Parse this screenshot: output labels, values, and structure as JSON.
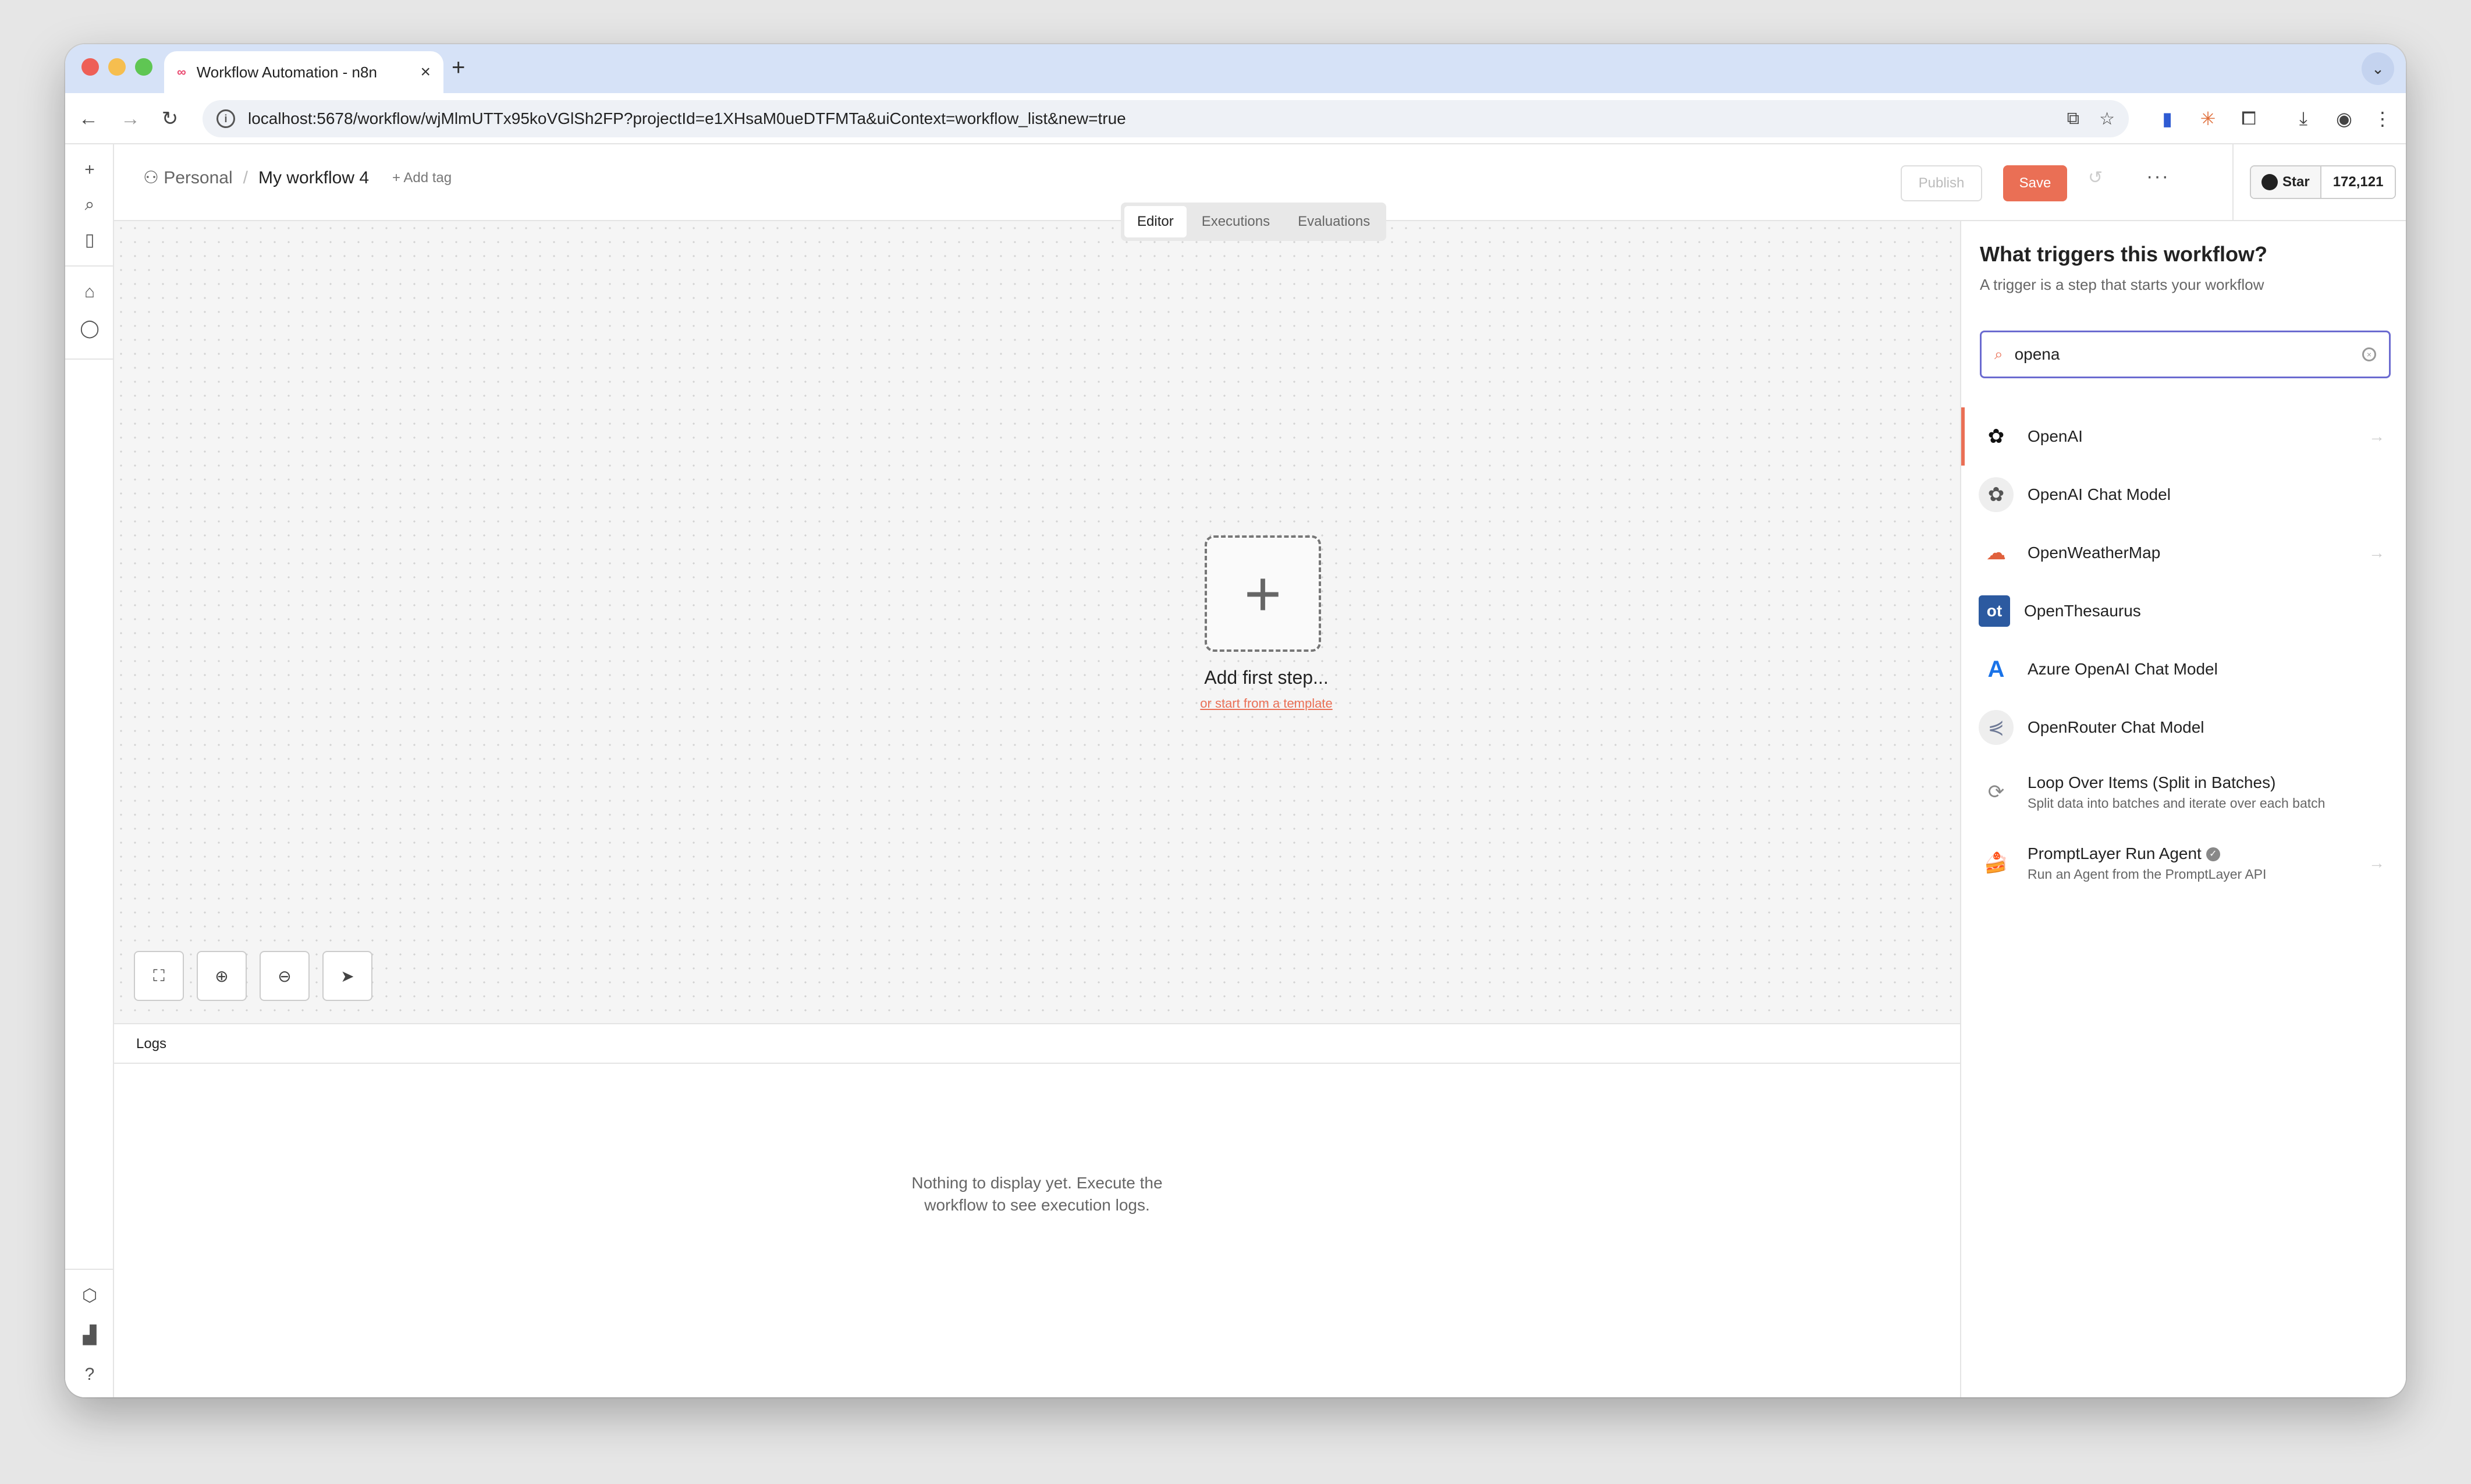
{
  "browser": {
    "tab_title": "Workflow Automation - n8n",
    "url": "localhost:5678/workflow/wjMlmUTTx95koVGlSh2FP?projectId=e1XHsaM0ueDTFMTa&uiContext=workflow_list&new=true"
  },
  "header": {
    "project": "Personal",
    "workflow_name": "My workflow 4",
    "add_tag": "+ Add tag",
    "publish_label": "Publish",
    "save_label": "Save",
    "more_label": "···",
    "star_label": "Star",
    "star_count": "172,121"
  },
  "view_tabs": [
    "Editor",
    "Executions",
    "Evaluations"
  ],
  "canvas": {
    "add_first_step": "Add first step...",
    "template_link": "or start from a template"
  },
  "logs": {
    "title": "Logs",
    "empty_line1": "Nothing to display yet. Execute the",
    "empty_line2": "workflow to see execution logs."
  },
  "panel": {
    "title": "What triggers this workflow?",
    "subtitle": "A trigger is a step that starts your workflow",
    "search_value": "opena",
    "nodes": [
      {
        "name": "OpenAI",
        "desc": "",
        "icon": "openai-icon"
      },
      {
        "name": "OpenAI Chat Model",
        "desc": "",
        "icon": "openai-icon"
      },
      {
        "name": "OpenWeatherMap",
        "desc": "",
        "icon": "weather-icon"
      },
      {
        "name": "OpenThesaurus",
        "desc": "",
        "icon": "openthesaurus-icon"
      },
      {
        "name": "Azure OpenAI Chat Model",
        "desc": "",
        "icon": "azure-icon"
      },
      {
        "name": "OpenRouter Chat Model",
        "desc": "",
        "icon": "openrouter-icon"
      },
      {
        "name": "Loop Over Items (Split in Batches)",
        "desc": "Split data into batches and iterate over each batch",
        "icon": "loop-icon"
      },
      {
        "name": "PromptLayer Run Agent",
        "desc": "Run an Agent from the PromptLayer API",
        "icon": "promptlayer-icon"
      }
    ]
  },
  "colors": {
    "accent": "#ea6f55",
    "search_border": "#6b6bd0"
  }
}
